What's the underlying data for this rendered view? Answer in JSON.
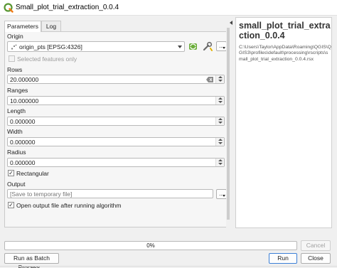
{
  "window": {
    "title": "Small_plot_trial_extraction_0.0.4"
  },
  "tabs": [
    {
      "label": "Parameters",
      "active": true
    },
    {
      "label": "Log",
      "active": false
    }
  ],
  "params": {
    "origin": {
      "label": "Origin",
      "value": "origin_pts [EPSG:4326]",
      "selected_only_label": "Selected features only",
      "selected_only_checked": false
    },
    "rows": {
      "label": "Rows",
      "value": "20.000000"
    },
    "ranges": {
      "label": "Ranges",
      "value": "10.000000"
    },
    "length": {
      "label": "Length",
      "value": "0.000000"
    },
    "width": {
      "label": "Width",
      "value": "0.000000"
    },
    "radius": {
      "label": "Radius",
      "value": "0.000000"
    },
    "rectangular": {
      "label": "Rectangular",
      "checked": true,
      "mark": "✓"
    },
    "output": {
      "label": "Output",
      "placeholder": "[Save to temporary file]",
      "open_after_label": "Open output file after running algorithm",
      "open_after_checked": true,
      "ellipsis": "..."
    }
  },
  "help": {
    "title": "small_plot_trial_extraction_0.0.4",
    "path": "C:\\Users\\Taylor\\AppData\\Roaming\\QGIS\\QGIS3\\profiles\\default\\processing\\rscripts\\small_plot_trial_extraction_0.0.4.rsx"
  },
  "progress": {
    "text": "0%",
    "value": 0
  },
  "buttons": {
    "cancel": "Cancel",
    "batch": "Run as Batch Process...",
    "run": "Run",
    "close": "Close"
  },
  "icons": {
    "app": "qgis-logo-icon",
    "iterate": "iterate-features-icon",
    "settings": "wrench-settings-icon"
  },
  "colors": {
    "qgis_green": "#589632",
    "qgis_yellow": "#ee7913",
    "default_button_border": "#3c7fd6"
  }
}
